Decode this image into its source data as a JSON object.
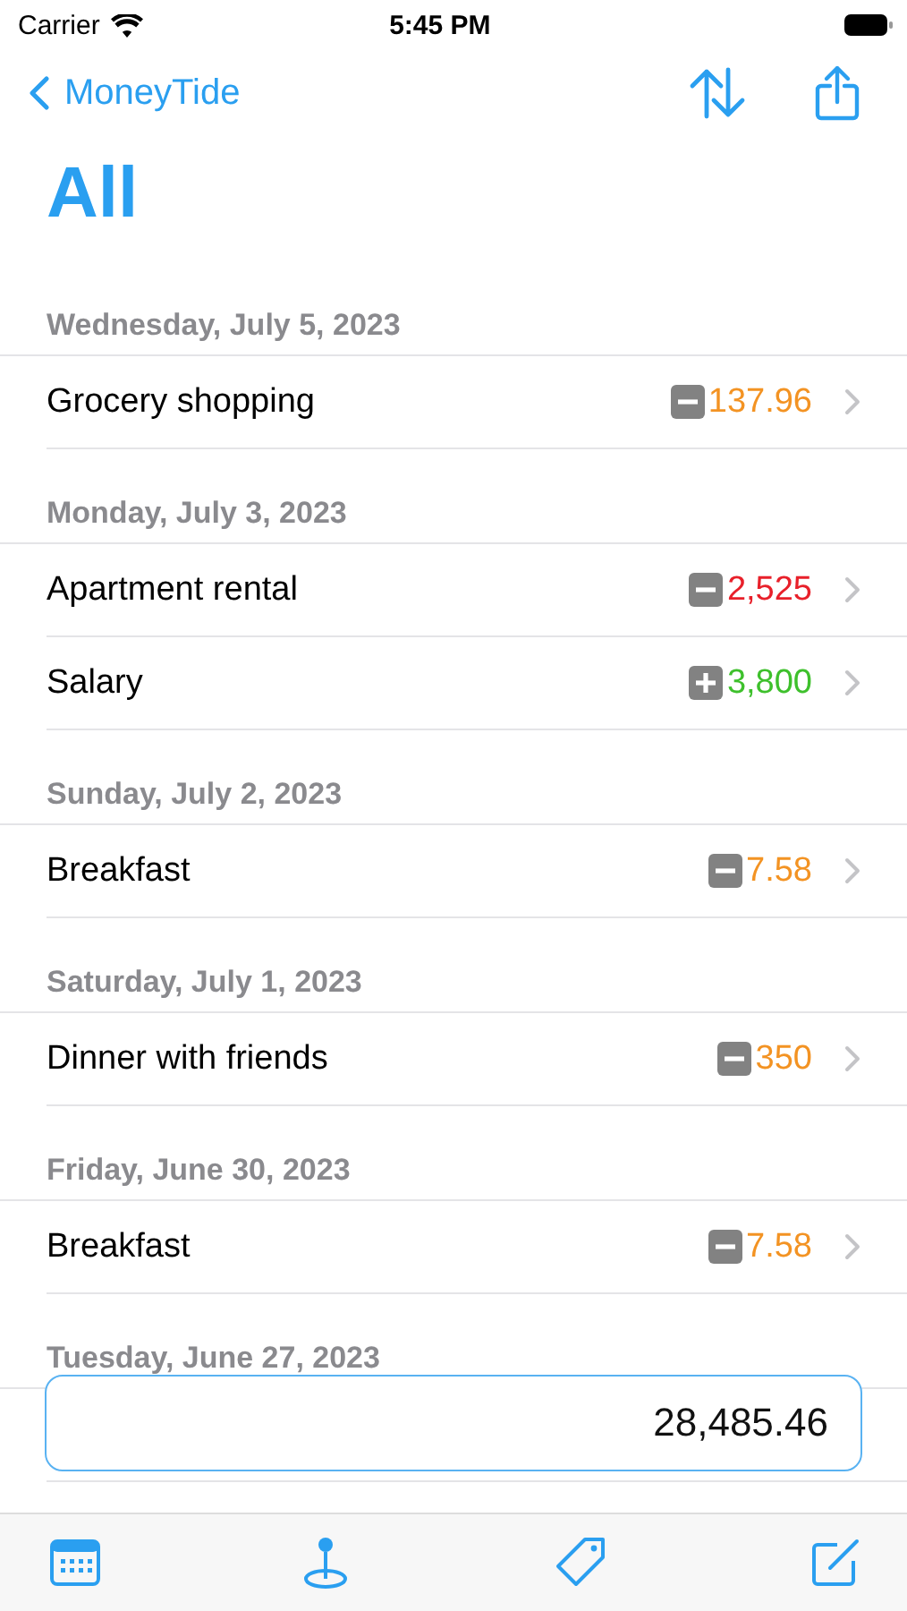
{
  "status_bar": {
    "carrier": "Carrier",
    "time": "5:45 PM"
  },
  "nav": {
    "back": "MoneyTide",
    "title": "All"
  },
  "sections": [
    {
      "date": "Wednesday, July 5, 2023",
      "rows": [
        {
          "name": "Grocery shopping",
          "kind": "expense",
          "amount": "137.96",
          "color": "#f39323"
        }
      ]
    },
    {
      "date": "Monday, July 3, 2023",
      "rows": [
        {
          "name": "Apartment rental",
          "kind": "expense",
          "amount": "2,525",
          "color": "#e8202a"
        },
        {
          "name": "Salary",
          "kind": "income",
          "amount": "3,800",
          "color": "#3ec02c"
        }
      ]
    },
    {
      "date": "Sunday, July 2, 2023",
      "rows": [
        {
          "name": "Breakfast",
          "kind": "expense",
          "amount": "7.58",
          "color": "#f39323"
        }
      ]
    },
    {
      "date": "Saturday, July 1, 2023",
      "rows": [
        {
          "name": "Dinner with friends",
          "kind": "expense",
          "amount": "350",
          "color": "#f39323"
        }
      ]
    },
    {
      "date": "Friday, June 30, 2023",
      "rows": [
        {
          "name": "Breakfast",
          "kind": "expense",
          "amount": "7.58",
          "color": "#f39323"
        }
      ]
    },
    {
      "date": "Tuesday, June 27, 2023"
    }
  ],
  "total": "28,485.46"
}
